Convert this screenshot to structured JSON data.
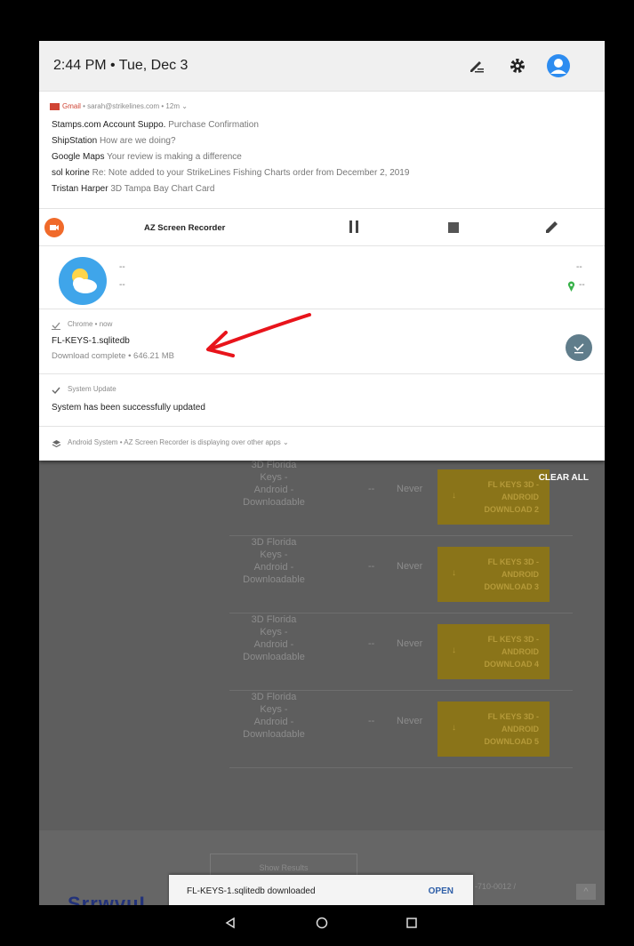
{
  "status_bar": {
    "time_date": "2:44 PM • Tue, Dec 3"
  },
  "gmail_notification": {
    "app": "Gmail",
    "account_time": " • sarah@strikelines.com • 12m ⌄",
    "messages": [
      {
        "sender": "Stamps.com Account Suppo.",
        "subject": "Purchase Confirmation"
      },
      {
        "sender": "ShipStation",
        "subject": "How are we doing?"
      },
      {
        "sender": "Google Maps",
        "subject": "Your review is making a difference"
      },
      {
        "sender": "sol korine",
        "subject": "Re: Note added to your StrikeLines Fishing Charts order from December 2, 2019"
      },
      {
        "sender": "Tristan Harper",
        "subject": "3D Tampa Bay Chart Card"
      }
    ]
  },
  "recorder_notification": {
    "title": "AZ Screen Recorder"
  },
  "weather_notification": {
    "left_top": "--",
    "left_bottom": "--",
    "right_top": "--",
    "right_bottom": "--"
  },
  "chrome_notification": {
    "source": "Chrome • now",
    "title": "FL-KEYS-1.sqlitedb",
    "subtitle": "Download complete • 646.21 MB"
  },
  "system_update": {
    "source": "System Update",
    "title": "System has been successfully updated"
  },
  "android_system": {
    "text": "Android System • AZ Screen Recorder is displaying over other apps ⌄"
  },
  "clear_all": "CLEAR ALL",
  "background_page": {
    "rows": [
      {
        "name_lines": [
          "3D Florida",
          "Keys -",
          "Android -",
          "Downloadable"
        ],
        "dash": "--",
        "expiry": "Never",
        "button": [
          "FL KEYS 3D -",
          "ANDROID",
          "DOWNLOAD 2"
        ]
      },
      {
        "name_lines": [
          "3D Florida",
          "Keys -",
          "Android -",
          "Downloadable"
        ],
        "dash": "--",
        "expiry": "Never",
        "button": [
          "FL KEYS 3D -",
          "ANDROID",
          "DOWNLOAD 3"
        ]
      },
      {
        "name_lines": [
          "3D Florida",
          "Keys -",
          "Android -",
          "Downloadable"
        ],
        "dash": "--",
        "expiry": "Never",
        "button": [
          "FL KEYS 3D -",
          "ANDROID",
          "DOWNLOAD 4"
        ]
      },
      {
        "name_lines": [
          "3D Florida",
          "Keys -",
          "Android -",
          "Downloadable"
        ],
        "dash": "--",
        "expiry": "Never",
        "button": [
          "FL KEYS 3D -",
          "ANDROID",
          "DOWNLOAD 5"
        ]
      }
    ],
    "show_results": "Show Results",
    "brand_partial": "SrrwvuL",
    "code_partial": "-710-0012 /",
    "up_button": "^"
  },
  "snackbar": {
    "text": "FL-KEYS-1.sqlitedb downloaded",
    "action": "OPEN"
  },
  "colors": {
    "gmail_red": "#d04434",
    "recorder_orange": "#f06a2a",
    "weather_blue": "#3fa5ea",
    "download_circle": "#607d8b",
    "annotation_arrow": "#e8141b",
    "button_gold_dimmed": "#8a7419"
  },
  "icons": [
    "edit-icon",
    "settings-gear-icon",
    "account-avatar-icon",
    "gmail-icon",
    "recorder-icon",
    "pause-icon",
    "stop-icon",
    "pencil-icon",
    "weather-icon",
    "location-pin-icon",
    "download-done-icon",
    "checkmark-icon",
    "layers-icon",
    "back-icon",
    "home-icon",
    "recents-icon"
  ]
}
